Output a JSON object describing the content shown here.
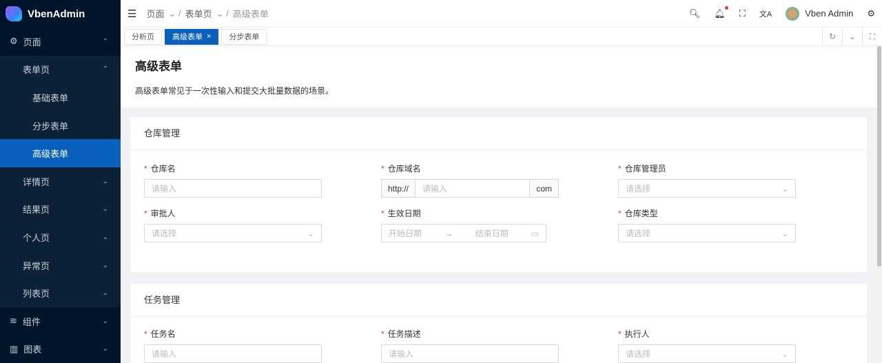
{
  "app": {
    "name": "VbenAdmin"
  },
  "sidebar": {
    "items": [
      {
        "label": "页面",
        "icon": "page-icon",
        "open": true
      },
      {
        "label": "表单页",
        "open": true
      },
      {
        "label": "基础表单"
      },
      {
        "label": "分步表单"
      },
      {
        "label": "高级表单",
        "active": true
      },
      {
        "label": "详情页"
      },
      {
        "label": "结果页"
      },
      {
        "label": "个人页"
      },
      {
        "label": "异常页"
      },
      {
        "label": "列表页"
      },
      {
        "label": "组件",
        "icon": "component-icon"
      },
      {
        "label": "图表",
        "icon": "chart-icon"
      }
    ]
  },
  "header": {
    "breadcrumb": [
      "页面",
      "表单页",
      "高级表单"
    ],
    "user": "Vben Admin"
  },
  "tabs": [
    "分析页",
    "高级表单",
    "分步表单"
  ],
  "page": {
    "title": "高级表单",
    "description": "高级表单常见于一次性输入和提交大批量数据的场景。"
  },
  "card1": {
    "title": "仓库管理",
    "fields": [
      {
        "label": "仓库名",
        "placeholder": "请输入"
      },
      {
        "label": "仓库域名",
        "prefix": "http://",
        "placeholder": "请输入",
        "suffix": "com"
      },
      {
        "label": "仓库管理员",
        "placeholder": "请选择"
      },
      {
        "label": "审批人",
        "placeholder": "请选择"
      },
      {
        "label": "生效日期",
        "start": "开始日期",
        "end": "结束日期"
      },
      {
        "label": "仓库类型",
        "placeholder": "请选择"
      }
    ]
  },
  "card2": {
    "title": "任务管理",
    "fields": [
      {
        "label": "任务名",
        "placeholder": "请输入"
      },
      {
        "label": "任务描述",
        "placeholder": "请输入"
      },
      {
        "label": "执行人",
        "placeholder": "请选择"
      }
    ]
  }
}
